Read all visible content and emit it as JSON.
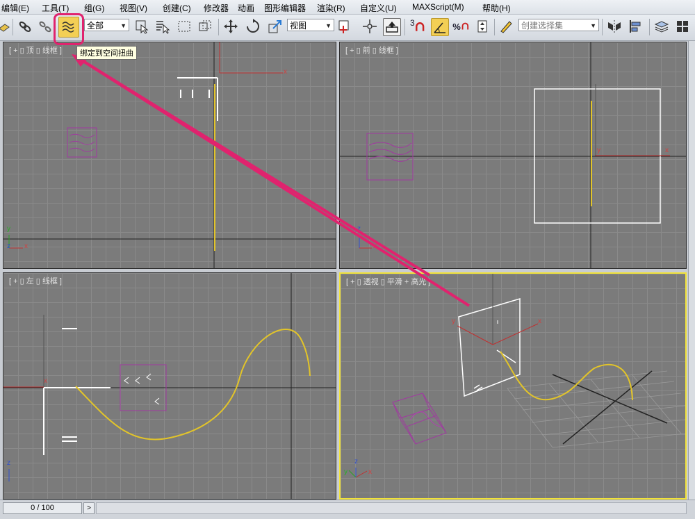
{
  "menu": {
    "edit": "编辑(E)",
    "tools": "工具(T)",
    "group": "组(G)",
    "views": "视图(V)",
    "create": "创建(C)",
    "modifiers": "修改器",
    "animation": "动画",
    "graph_editors": "图形编辑器",
    "rendering": "渲染(R)",
    "customize": "自定义(U)",
    "maxscript": "MAXScript(M)",
    "help": "帮助(H)"
  },
  "toolbar": {
    "selection_filter": "全部",
    "ref_coord": "视图",
    "snap_value": "3",
    "named_selection_placeholder": "创建选择集",
    "tooltip": "绑定到空间扭曲"
  },
  "viewports": {
    "top": "[ + ▯ 顶 ▯ 线框 ]",
    "front": "[ + ▯ 前 ▯ 线框 ]",
    "left": "[ + ▯ 左 ▯ 线框 ]",
    "perspective": "[ + ▯ 透视 ▯ 平滑 + 高光 ]"
  },
  "axis": {
    "x": "x",
    "y": "y",
    "z": "z"
  },
  "timeline": {
    "frame": "0 / 100",
    "next": ">"
  },
  "colors": {
    "highlight": "#e0236e",
    "active_viewport": "#f2e33a",
    "spacewarp": "#a03aa0",
    "spline": "#e8c020",
    "viewport_bg": "#7b7b7b"
  }
}
